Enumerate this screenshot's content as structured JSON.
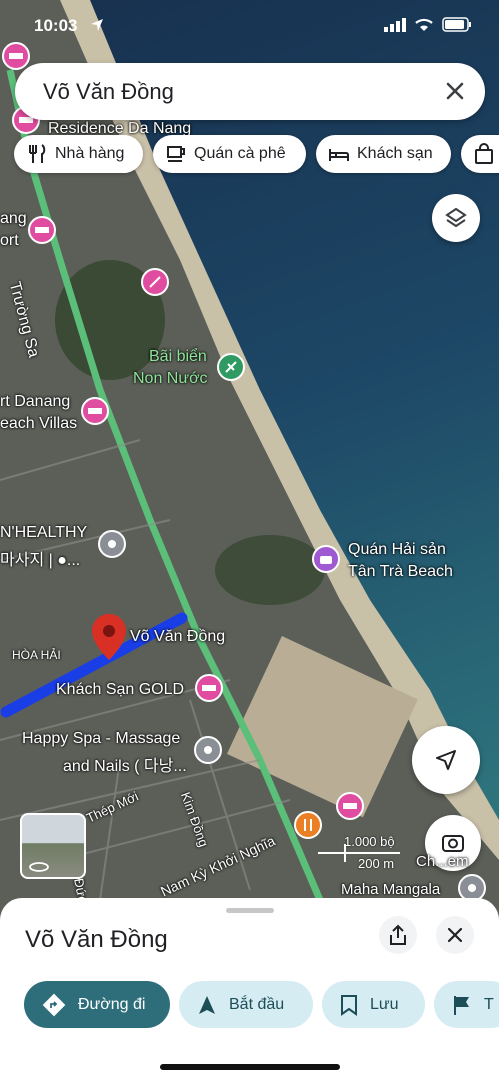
{
  "status_bar": {
    "time": "10:03"
  },
  "search": {
    "query": "Võ Văn Đồng"
  },
  "chips": [
    {
      "label": "Nhà hàng",
      "icon": "fork-knife-icon"
    },
    {
      "label": "Quán cà phê",
      "icon": "coffee-cup-icon"
    },
    {
      "label": "Khách sạn",
      "icon": "bed-icon"
    },
    {
      "label": "",
      "icon": "shopping-bag-icon"
    }
  ],
  "map": {
    "labels": {
      "residence": "Residence Da Nang",
      "truong_sa": "Trường Sa",
      "resort_left_1": "ang",
      "resort_left_2": "ort",
      "bai_bien_1": "Bãi biển",
      "bai_bien_2": "Non Nước",
      "danang_villas_1": "rt Danang",
      "danang_villas_2": "each Villas",
      "healthy_1": "N'HEALTHY",
      "healthy_2": "마사지 | ●...",
      "quan_hai_san_1": "Quán Hải sản",
      "quan_hai_san_2": "Tân Trà Beach",
      "street_name": "Võ Văn Đồng",
      "hoa_hai": "HÒA HẢI",
      "khach_san_gold": "Khách Sạn GOLD",
      "happy_spa_1": "Happy Spa - Massage",
      "happy_spa_2": "and Nails ( 다낭...",
      "thep_moi": "Thép Mới",
      "kim_dong": "Kim Đồng",
      "nam_ky": "Nam Kỳ Khởi Nghĩa",
      "maha_mangala": "Maha Mangala",
      "duc": "Đức",
      "street_view": "Ch...em"
    },
    "scale": {
      "feet": "1.000 bộ",
      "meters": "200 m"
    }
  },
  "sheet": {
    "title": "Võ Văn Đồng",
    "actions": [
      {
        "label": "Đường đi"
      },
      {
        "label": "Bắt đầu"
      },
      {
        "label": "Lưu"
      },
      {
        "label": "T"
      }
    ]
  },
  "colors": {
    "primary": "#2e6e7a",
    "secondary_bg": "#d6ecf3",
    "route_blue": "#1a3ee6",
    "pin_red": "#d93025"
  }
}
